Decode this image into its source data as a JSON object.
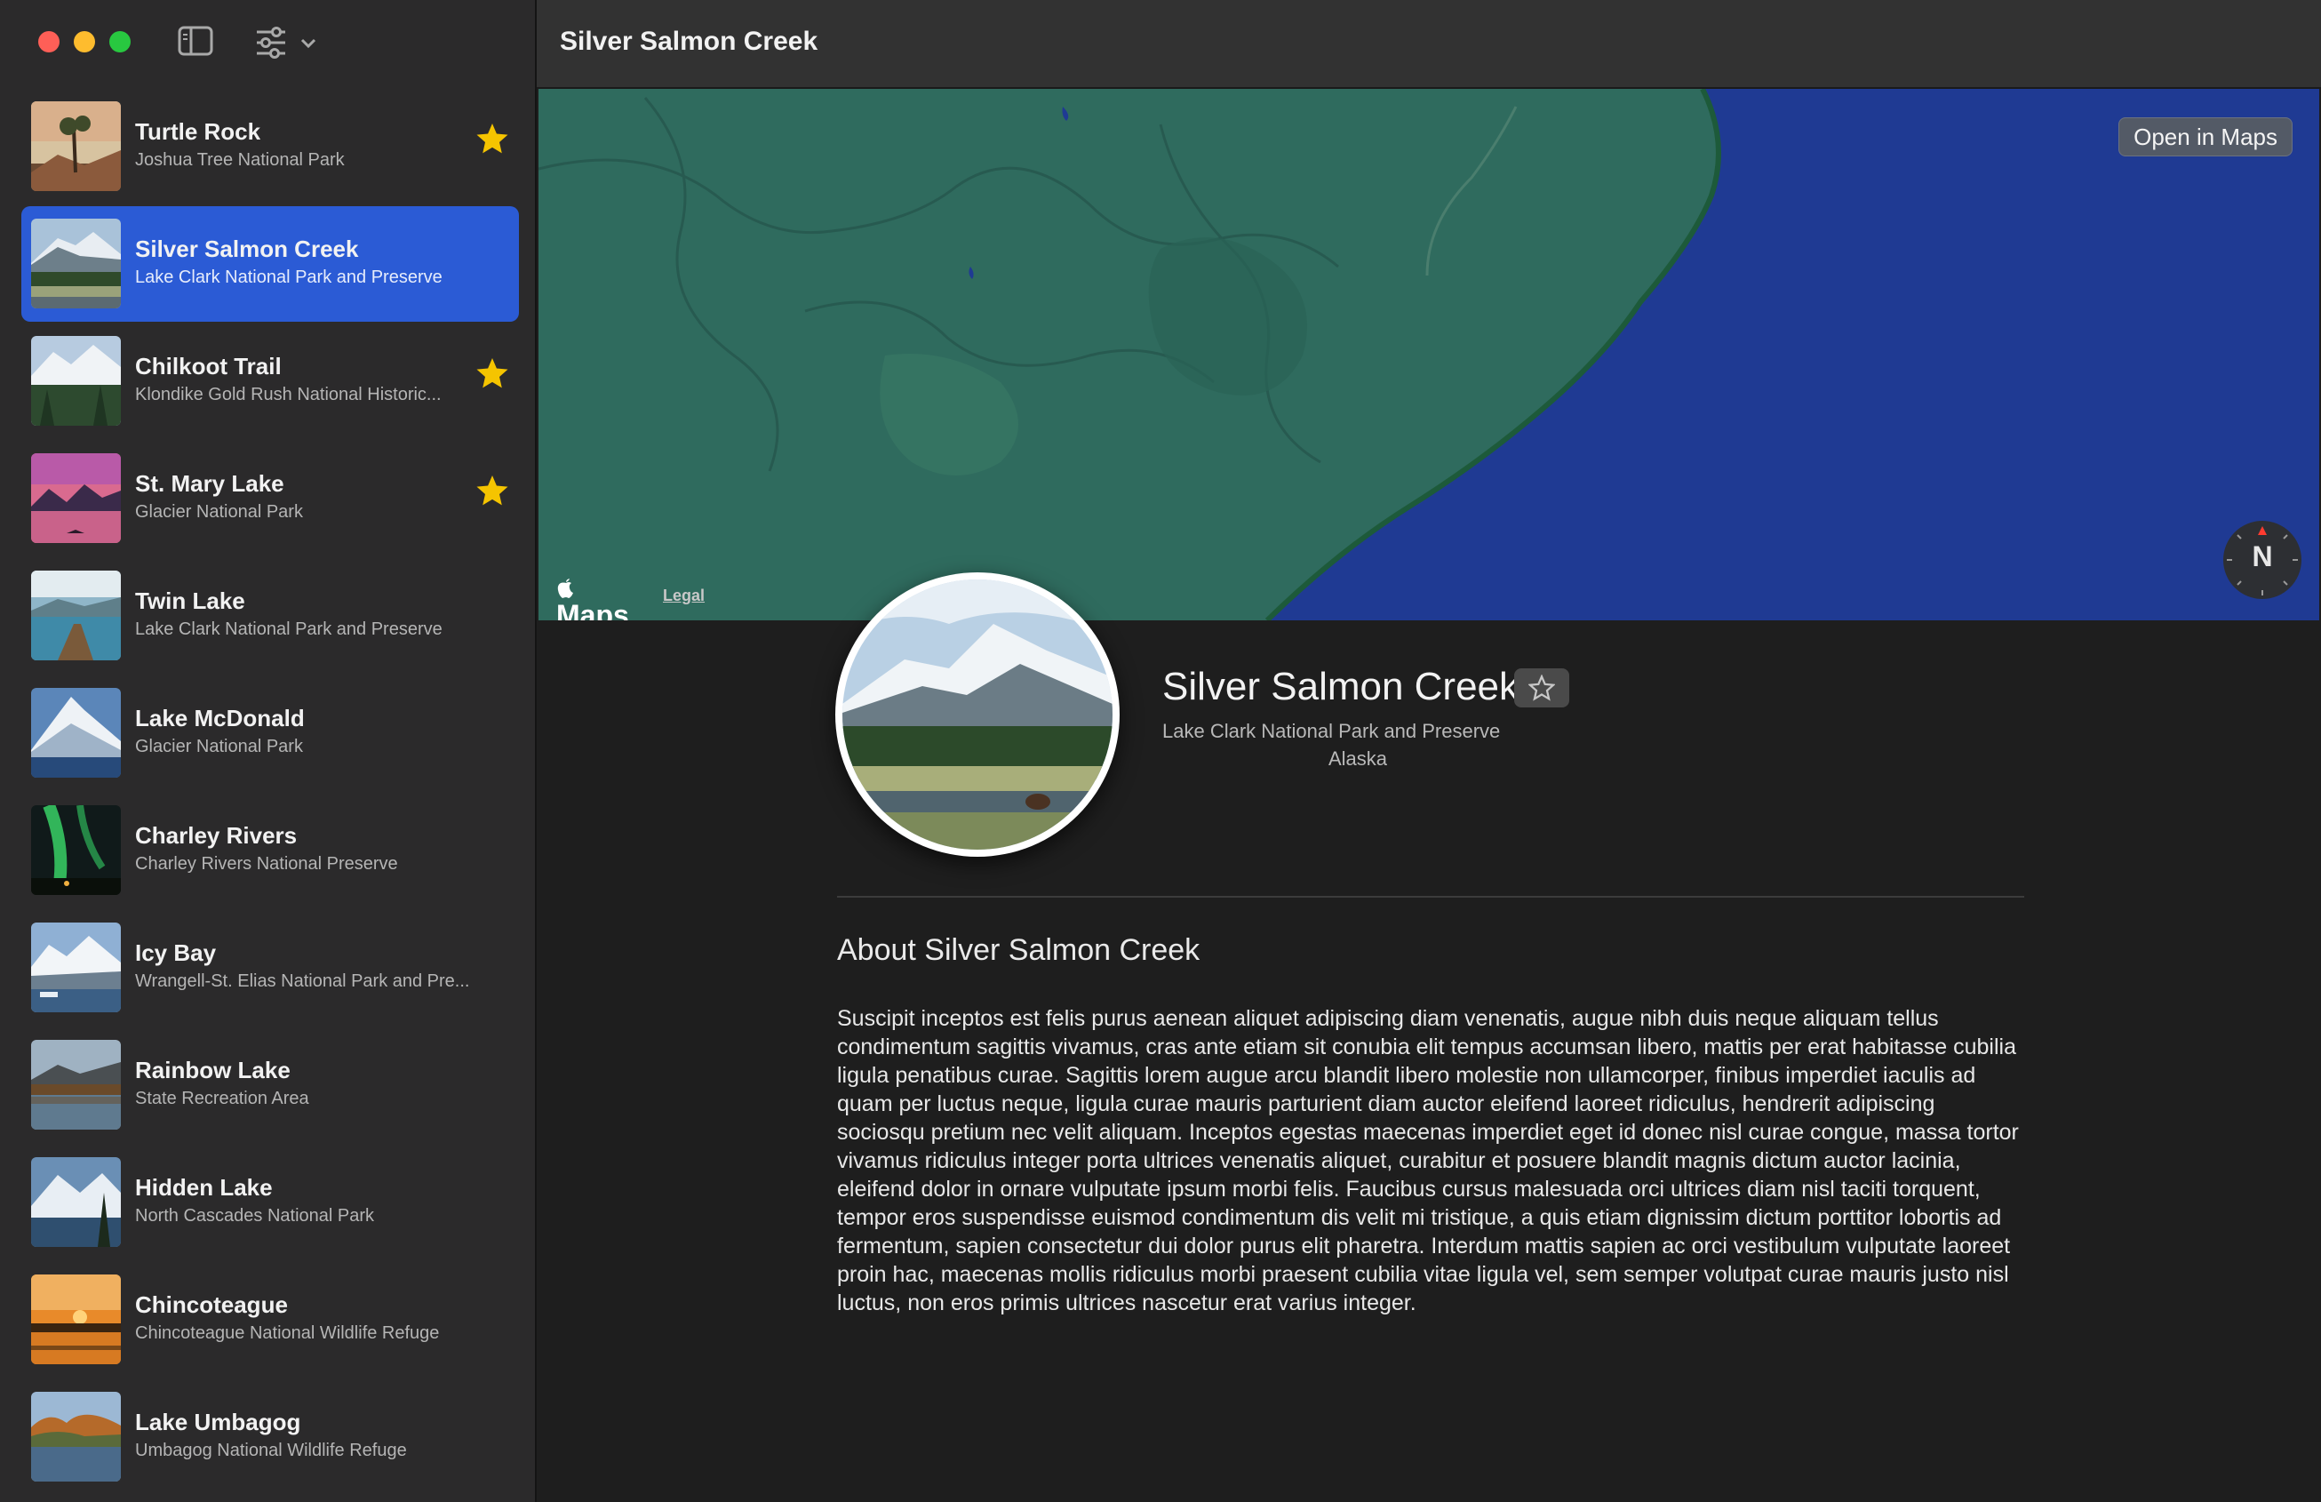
{
  "window": {
    "title": "Silver Salmon Creek"
  },
  "toolbar": {
    "sidebar_toggle_icon": "sidebar-left-icon",
    "filter_icon": "sliders-icon",
    "filter_menu_icon": "chevron-down-icon"
  },
  "landmarks": [
    {
      "name": "Turtle Rock",
      "park": "Joshua Tree National Park",
      "favorite": true
    },
    {
      "name": "Silver Salmon Creek",
      "park": "Lake Clark National Park and Preserve",
      "favorite": false,
      "selected": true
    },
    {
      "name": "Chilkoot Trail",
      "park": "Klondike Gold Rush National Historic...",
      "favorite": true
    },
    {
      "name": "St. Mary Lake",
      "park": "Glacier National Park",
      "favorite": true
    },
    {
      "name": "Twin Lake",
      "park": "Lake Clark National Park and Preserve",
      "favorite": false
    },
    {
      "name": "Lake McDonald",
      "park": "Glacier National Park",
      "favorite": false
    },
    {
      "name": "Charley Rivers",
      "park": "Charley Rivers National Preserve",
      "favorite": false
    },
    {
      "name": "Icy Bay",
      "park": "Wrangell-St. Elias National Park and Pre...",
      "favorite": false
    },
    {
      "name": "Rainbow Lake",
      "park": "State Recreation Area",
      "favorite": false
    },
    {
      "name": "Hidden Lake",
      "park": "North Cascades National Park",
      "favorite": false
    },
    {
      "name": "Chincoteague",
      "park": "Chincoteague National Wildlife Refuge",
      "favorite": false
    },
    {
      "name": "Lake Umbagog",
      "park": "Umbagog National Wildlife Refuge",
      "favorite": false
    }
  ],
  "map": {
    "open_in_maps": "Open in Maps",
    "logo": "Maps",
    "legal": "Legal",
    "compass": "N"
  },
  "detail": {
    "name": "Silver Salmon Creek",
    "park": "Lake Clark National Park and Preserve",
    "state": "Alaska",
    "favorite": false,
    "about_title": "About Silver Salmon Creek",
    "about_text": "Suscipit inceptos est felis purus aenean aliquet adipiscing diam venenatis, augue nibh duis neque aliquam tellus condimentum sagittis vivamus, cras ante etiam sit conubia elit tempus accumsan libero, mattis per erat habitasse cubilia ligula penatibus curae. Sagittis lorem augue arcu blandit libero molestie non ullamcorper, finibus imperdiet iaculis ad quam per luctus neque, ligula curae mauris parturient diam auctor eleifend laoreet ridiculus, hendrerit adipiscing sociosqu pretium nec velit aliquam. Inceptos egestas maecenas imperdiet eget id donec nisl curae congue, massa tortor vivamus ridiculus integer porta ultrices venenatis aliquet, curabitur et posuere blandit magnis dictum auctor lacinia, eleifend dolor in ornare vulputate ipsum morbi felis. Faucibus cursus malesuada orci ultrices diam nisl taciti torquent, tempor eros suspendisse euismod condimentum dis velit mi tristique, a quis etiam dignissim dictum porttitor lobortis ad fermentum, sapien consectetur dui dolor purus elit pharetra. Interdum mattis sapien ac orci vestibulum vulputate laoreet proin hac, maecenas mollis ridiculus morbi praesent cubilia vitae ligula vel, sem semper volutpat curae mauris justo nisl luctus, non eros primis ultrices nascetur erat varius integer."
  },
  "colors": {
    "selection": "#2b5bd5",
    "star": "#f5c400",
    "map_land": "#2f6b5e",
    "map_water": "#1f3a93"
  }
}
